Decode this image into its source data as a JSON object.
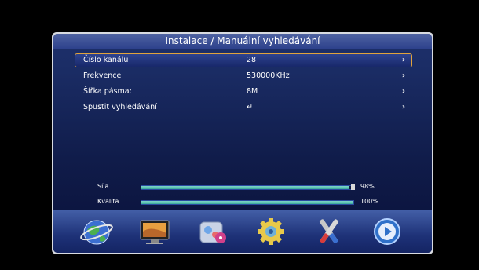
{
  "title": "Instalace / Manuální vyhledávání",
  "menu": [
    {
      "label": "Číslo kanálu",
      "value": "28",
      "arrow": "›",
      "selected": true
    },
    {
      "label": "Frekvence",
      "value": "530000KHz",
      "arrow": "›",
      "selected": false
    },
    {
      "label": "Šířka pásma:",
      "value": "8M",
      "arrow": "›",
      "selected": false
    },
    {
      "label": "Spustit vyhledávání",
      "value": "↵",
      "arrow": "›",
      "selected": false
    }
  ],
  "meters": {
    "strength": {
      "label": "Síla",
      "value_text": "98%",
      "level": 0.98
    },
    "quality": {
      "label": "Kvalita",
      "value_text": "100%",
      "level": 1.0
    }
  },
  "dock": {
    "icons": [
      "globe-icon",
      "tv-monitor-icon",
      "media-icon",
      "settings-gear-icon",
      "tools-icon",
      "play-icon"
    ]
  },
  "colors": {
    "panel_bg": "#1b2d66",
    "title_bg": "#3d519a",
    "selection_border": "#e1a33b",
    "meter_fill": "#5cc2b3"
  }
}
